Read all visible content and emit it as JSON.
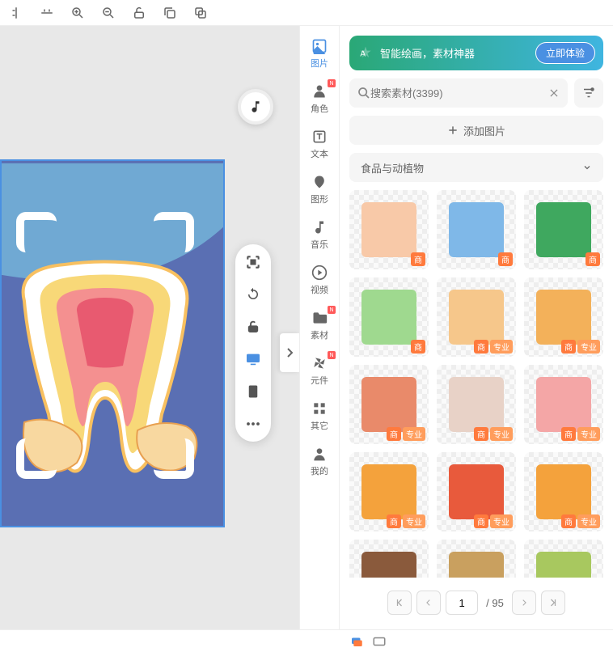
{
  "toolbar": {
    "icons": [
      "align-horizontal-icon",
      "align-vertical-icon",
      "zoom-in-icon",
      "zoom-out-icon",
      "unlock-icon",
      "copy-icon",
      "paste-icon"
    ]
  },
  "side_toolbar": {
    "items": [
      "focus-icon",
      "rotate-icon",
      "lock-icon",
      "display-icon",
      "tablet-icon",
      "more-icon"
    ]
  },
  "tabs": [
    {
      "key": "image",
      "label": "图片",
      "icon": "image-icon",
      "active": true,
      "badge": ""
    },
    {
      "key": "role",
      "label": "角色",
      "icon": "person-icon",
      "active": false,
      "badge": "N"
    },
    {
      "key": "text",
      "label": "文本",
      "icon": "text-icon",
      "active": false,
      "badge": ""
    },
    {
      "key": "shape",
      "label": "图形",
      "icon": "shape-icon",
      "active": false,
      "badge": ""
    },
    {
      "key": "music",
      "label": "音乐",
      "icon": "music-icon",
      "active": false,
      "badge": ""
    },
    {
      "key": "video",
      "label": "视频",
      "icon": "play-icon",
      "active": false,
      "badge": ""
    },
    {
      "key": "asset",
      "label": "素材",
      "icon": "folder-icon",
      "active": false,
      "badge": "N"
    },
    {
      "key": "component",
      "label": "元件",
      "icon": "pinwheel-icon",
      "active": false,
      "badge": "N"
    },
    {
      "key": "other",
      "label": "其它",
      "icon": "grid-icon",
      "active": false,
      "badge": ""
    },
    {
      "key": "mine",
      "label": "我的",
      "icon": "user-icon",
      "active": false,
      "badge": ""
    }
  ],
  "promo": {
    "text": "智能绘画，素材神器",
    "button": "立即体验"
  },
  "search": {
    "placeholder": "搜索素材(3399)"
  },
  "add_button": "添加图片",
  "category": "食品与动植物",
  "badge_labels": {
    "commercial": "商",
    "pro": "专业"
  },
  "assets": [
    {
      "name": "chicken-1",
      "color": "#f8c9a8",
      "badges": [
        "commercial"
      ]
    },
    {
      "name": "dots-blue",
      "color": "#7fb8e8",
      "badges": [
        "commercial"
      ]
    },
    {
      "name": "leaf-green",
      "color": "#3fa85f",
      "badges": [
        "commercial"
      ]
    },
    {
      "name": "dots-green",
      "color": "#9fd98f",
      "badges": [
        "commercial"
      ]
    },
    {
      "name": "chicken-plate",
      "color": "#f6c78b",
      "badges": [
        "commercial",
        "pro"
      ]
    },
    {
      "name": "pancake",
      "color": "#f3b15a",
      "badges": [
        "commercial",
        "pro"
      ]
    },
    {
      "name": "feast",
      "color": "#e98a6a",
      "badges": [
        "commercial",
        "pro"
      ]
    },
    {
      "name": "bottle",
      "color": "#e8d2c7",
      "badges": [
        "commercial",
        "pro"
      ]
    },
    {
      "name": "meat",
      "color": "#f4a6a6",
      "badges": [
        "commercial",
        "pro"
      ]
    },
    {
      "name": "bag",
      "color": "#f4a23c",
      "badges": [
        "commercial",
        "pro"
      ]
    },
    {
      "name": "bucket",
      "color": "#e85a3c",
      "badges": [
        "commercial",
        "pro"
      ]
    },
    {
      "name": "cookies",
      "color": "#f4a23c",
      "badges": [
        "commercial",
        "pro"
      ]
    },
    {
      "name": "chestnut",
      "color": "#8a5a3c",
      "badges": [
        "commercial",
        "pro"
      ]
    },
    {
      "name": "potato",
      "color": "#c9a05f",
      "badges": [
        "commercial",
        "pro"
      ]
    },
    {
      "name": "wheat",
      "color": "#a8c85f",
      "badges": [
        "commercial",
        "pro"
      ]
    }
  ],
  "pager": {
    "current": "1",
    "total": "/ 95"
  }
}
